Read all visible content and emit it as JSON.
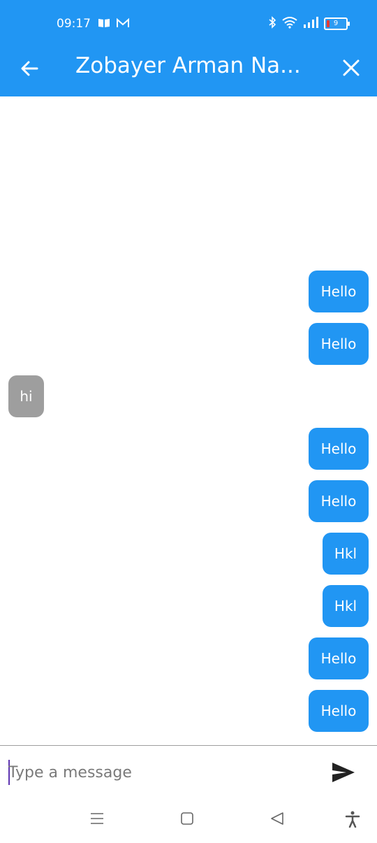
{
  "status_bar": {
    "time": "09:17",
    "battery": "9",
    "icons": [
      "book-icon",
      "gmail-icon",
      "bluetooth-icon",
      "wifi-icon",
      "signal-icon",
      "battery-icon"
    ]
  },
  "app_bar": {
    "title": "Zobayer Arman Na...",
    "back_icon": "arrow-left-icon",
    "close_icon": "close-icon",
    "color": "#2196F3"
  },
  "messages": [
    {
      "text": "Hello",
      "type": "sent"
    },
    {
      "text": "Hello",
      "type": "sent"
    },
    {
      "text": "hi",
      "type": "received"
    },
    {
      "text": "Hello",
      "type": "sent"
    },
    {
      "text": "Hello",
      "type": "sent"
    },
    {
      "text": "Hkl",
      "type": "sent"
    },
    {
      "text": "Hkl",
      "type": "sent"
    },
    {
      "text": "Hello",
      "type": "sent"
    },
    {
      "text": "Hello",
      "type": "sent"
    }
  ],
  "composer": {
    "placeholder": "Type a message",
    "value": "",
    "send_icon": "send-icon"
  },
  "nav_bar": {
    "icons": [
      "menu-icon",
      "home-icon",
      "back-icon",
      "accessibility-icon"
    ]
  },
  "colors": {
    "sent_bubble": "#2196F3",
    "received_bubble": "#9E9E9E"
  }
}
